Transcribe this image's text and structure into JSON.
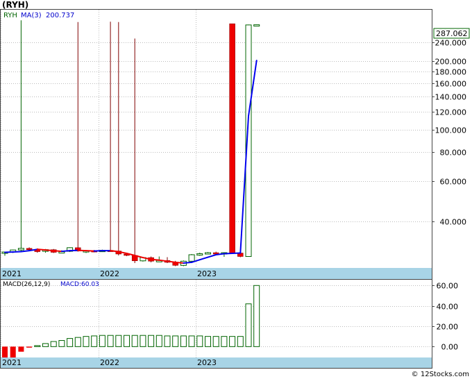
{
  "ticker_title": "(RYH)",
  "price_legend": {
    "symbol": "RYH",
    "ma_label": "MA(3)",
    "ma_value": "200.737"
  },
  "last_price_label": "287.062",
  "macd_legend": {
    "label": "MACD(26,12,9)",
    "value_label": "MACD:60.03"
  },
  "footer": "© 12Stocks.com",
  "colors": {
    "up": "#006400",
    "down": "#ee0000",
    "wick_down": "#800000",
    "ma_blue": "#0000ee",
    "ma_red": "#ee0000",
    "axis_band": "#a8d4e6",
    "grid": "#bbbbbb",
    "legend_blue": "#0000cc"
  },
  "chart_data": [
    {
      "type": "candlestick",
      "title": "(RYH)",
      "y_scale": "log",
      "ylim": [
        25.5,
        320
      ],
      "y_ticks": [
        40,
        60,
        80,
        100,
        120,
        140,
        160,
        180,
        200,
        240
      ],
      "y_tick_labels": [
        "40.000",
        "60.000",
        "80.000",
        "100.000",
        "120.000",
        "140.000",
        "160.000",
        "180.000",
        "200.000",
        "240.000"
      ],
      "x_labels": [
        "2021",
        "2022",
        "2023"
      ],
      "x_label_index": [
        0,
        12,
        24
      ],
      "last_value": 287.062,
      "candles": [
        {
          "o": 29.2,
          "h": 29.6,
          "l": 28.4,
          "c": 29.5
        },
        {
          "o": 29.5,
          "h": 30.2,
          "l": 29.2,
          "c": 30.1
        },
        {
          "o": 30.1,
          "h": 300,
          "l": 29.8,
          "c": 30.6
        },
        {
          "o": 30.6,
          "h": 30.9,
          "l": 30.0,
          "c": 30.2
        },
        {
          "o": 30.2,
          "h": 30.6,
          "l": 29.3,
          "c": 29.6
        },
        {
          "o": 29.7,
          "h": 30.4,
          "l": 29.3,
          "c": 30.2
        },
        {
          "o": 30.2,
          "h": 30.4,
          "l": 29.2,
          "c": 29.4
        },
        {
          "o": 29.4,
          "h": 30.0,
          "l": 29.2,
          "c": 29.6
        },
        {
          "o": 29.7,
          "h": 30.9,
          "l": 29.5,
          "c": 30.8
        },
        {
          "o": 30.8,
          "h": 295,
          "l": 29.6,
          "c": 29.8
        },
        {
          "o": 29.8,
          "h": 30.0,
          "l": 29.2,
          "c": 29.9
        },
        {
          "o": 29.9,
          "h": 30.1,
          "l": 29.4,
          "c": 29.8
        },
        {
          "o": 29.8,
          "h": 30.2,
          "l": 29.5,
          "c": 30.0
        },
        {
          "o": 30.0,
          "h": 296,
          "l": 29.6,
          "c": 29.8
        },
        {
          "o": 29.8,
          "h": 295,
          "l": 28.5,
          "c": 28.9
        },
        {
          "o": 28.9,
          "h": 29.2,
          "l": 28.3,
          "c": 28.5
        },
        {
          "o": 28.5,
          "h": 250,
          "l": 26.4,
          "c": 27.0
        },
        {
          "o": 27.0,
          "h": 28.1,
          "l": 26.8,
          "c": 27.9
        },
        {
          "o": 27.9,
          "h": 28.2,
          "l": 26.6,
          "c": 26.9
        },
        {
          "o": 27.0,
          "h": 28.2,
          "l": 26.8,
          "c": 27.1
        },
        {
          "o": 27.1,
          "h": 28.0,
          "l": 26.4,
          "c": 26.6
        },
        {
          "o": 26.6,
          "h": 27.0,
          "l": 25.6,
          "c": 25.8
        },
        {
          "o": 25.8,
          "h": 27.1,
          "l": 25.6,
          "c": 26.9
        },
        {
          "o": 26.9,
          "h": 28.9,
          "l": 26.7,
          "c": 28.7
        },
        {
          "o": 28.7,
          "h": 29.3,
          "l": 28.4,
          "c": 29.0
        },
        {
          "o": 29.0,
          "h": 29.5,
          "l": 28.8,
          "c": 29.3
        },
        {
          "o": 29.3,
          "h": 29.6,
          "l": 28.6,
          "c": 28.9
        },
        {
          "o": 28.9,
          "h": 29.4,
          "l": 28.1,
          "c": 29.3
        },
        {
          "o": 290,
          "h": 290,
          "l": 28.9,
          "c": 29.2
        },
        {
          "o": 29.2,
          "h": 29.5,
          "l": 28.0,
          "c": 28.2
        },
        {
          "o": 28.2,
          "h": 287.5,
          "l": 28.2,
          "c": 286.5
        },
        {
          "o": 287.0,
          "h": 287.6,
          "l": 286.5,
          "c": 287.062
        }
      ],
      "ma3": [
        29.4,
        29.5,
        29.6,
        29.9,
        30.3,
        30.1,
        29.9,
        29.7,
        29.9,
        30.0,
        29.9,
        29.8,
        29.9,
        29.9,
        29.6,
        29.1,
        28.5,
        27.9,
        27.4,
        27.2,
        26.9,
        26.6,
        26.4,
        26.6,
        27.3,
        28.0,
        28.7,
        29.0,
        29.1,
        29.2,
        115,
        200.737
      ]
    },
    {
      "type": "bar",
      "title": "MACD(26,12,9)",
      "last_value": 60.03,
      "ylim": [
        -10,
        65
      ],
      "y_ticks": [
        0,
        20,
        40,
        60
      ],
      "y_tick_labels": [
        "0.00",
        "20.00",
        "40.00",
        "60.00"
      ],
      "x_labels": [
        "2021",
        "2022",
        "2023"
      ],
      "x_label_index": [
        0,
        12,
        24
      ],
      "values": [
        -18,
        -11,
        -5,
        -1,
        1,
        3,
        5,
        6,
        8,
        9,
        10,
        10.5,
        11,
        11,
        11,
        11,
        11,
        11,
        11,
        11,
        10.5,
        10.5,
        10.5,
        10.5,
        10.5,
        10,
        10,
        10,
        10,
        10,
        42,
        60.03
      ]
    }
  ]
}
